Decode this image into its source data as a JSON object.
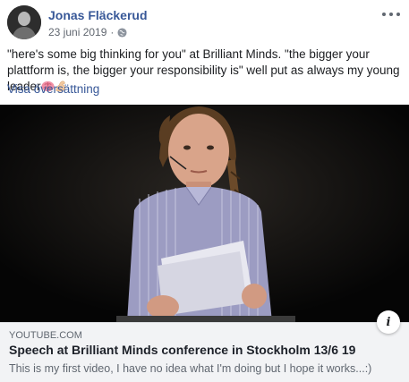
{
  "post": {
    "author": "Jonas Fläckerud",
    "date": "23 juni 2019",
    "separator": "·",
    "privacy_icon": "globe-icon",
    "text": "\"here's some big thinking for you\" at Brilliant Minds. \"the bigger your plattform is, the bigger your responsibility is\" well put as always my young leader",
    "emojis": [
      "brain-emoji",
      "flexed-biceps-emoji"
    ],
    "translate_label": "Visa översättning"
  },
  "link": {
    "domain": "YOUTUBE.COM",
    "title": "Speech at Brilliant Minds conference in Stockholm 13/6 19",
    "description": "This is my first video, I have no idea what I'm doing but I hope it works...:)",
    "info_icon_label": "i"
  },
  "colors": {
    "link_blue": "#385898",
    "meta_gray": "#616770",
    "card_bg": "#f2f3f5"
  }
}
